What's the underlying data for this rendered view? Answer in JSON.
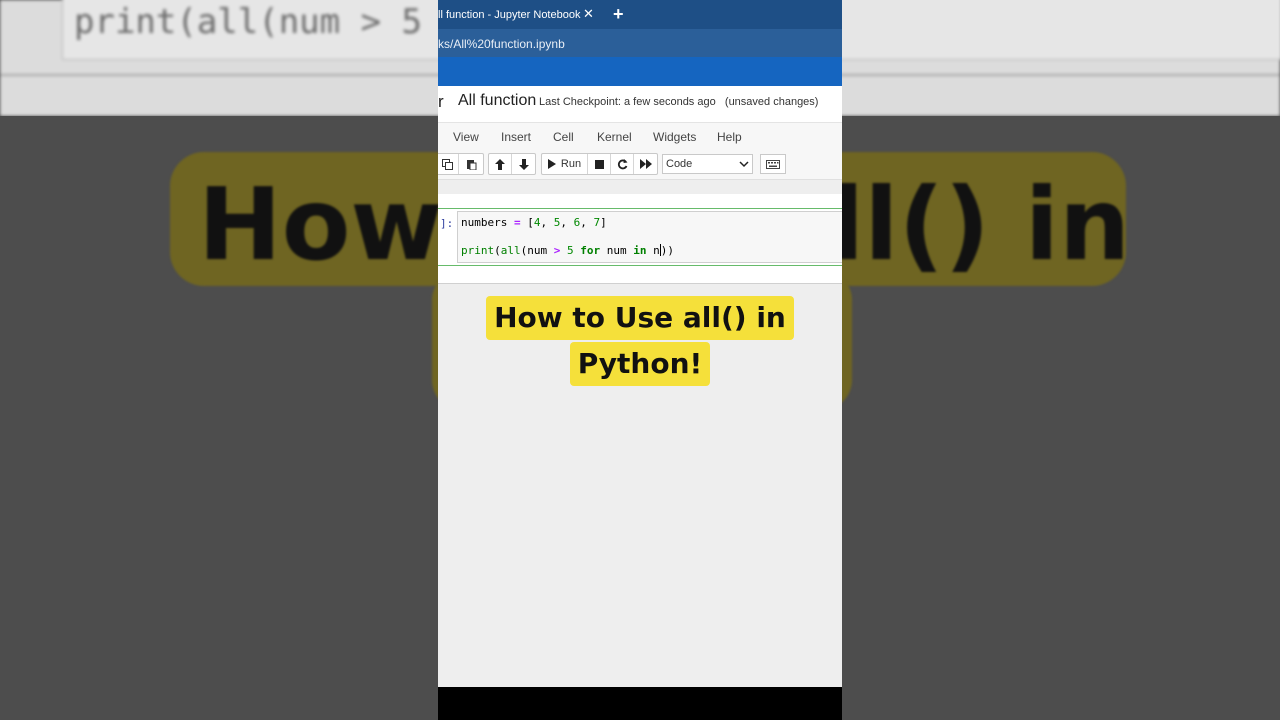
{
  "background": {
    "code_text": "print(all(num > 5",
    "big_left": "How",
    "big_right": "ll() in"
  },
  "browser": {
    "tab_title": "ll function - Jupyter Notebook",
    "close_glyph": "✕",
    "new_tab_glyph": "+",
    "url": "ks/All%20function.ipynb"
  },
  "notebook": {
    "logo_fragment": "r",
    "name": "All function",
    "checkpoint": "Last Checkpoint: a few seconds ago",
    "unsaved": "(unsaved changes)"
  },
  "menu": [
    "View",
    "Insert",
    "Cell",
    "Kernel",
    "Widgets",
    "Help"
  ],
  "toolbar": {
    "run_label": "Run",
    "cell_type": "Code"
  },
  "cell": {
    "prompt": "]:",
    "line1": {
      "a": "numbers ",
      "eq": "=",
      "b": " [",
      "n1": "4",
      "c1": ", ",
      "n2": "5",
      "c2": ", ",
      "n3": "6",
      "c3": ", ",
      "n4": "7",
      "end": "]"
    },
    "line2": {
      "print": "print",
      "p1": "(",
      "all": "all",
      "p2": "(num ",
      "gt": ">",
      "sp": " ",
      "five": "5",
      "sp2": " ",
      "for": "for",
      "mid": " num ",
      "in": "in",
      "tail1": " n",
      "tail2": "))"
    }
  },
  "caption": {
    "line1": "How to Use all() in",
    "line2": "Python!"
  },
  "colors": {
    "tab_bar": "#1e4f86",
    "jupyter_header": "#1565c0",
    "caption_bg": "#f5e03a",
    "cell_border": "#66bb6a"
  }
}
